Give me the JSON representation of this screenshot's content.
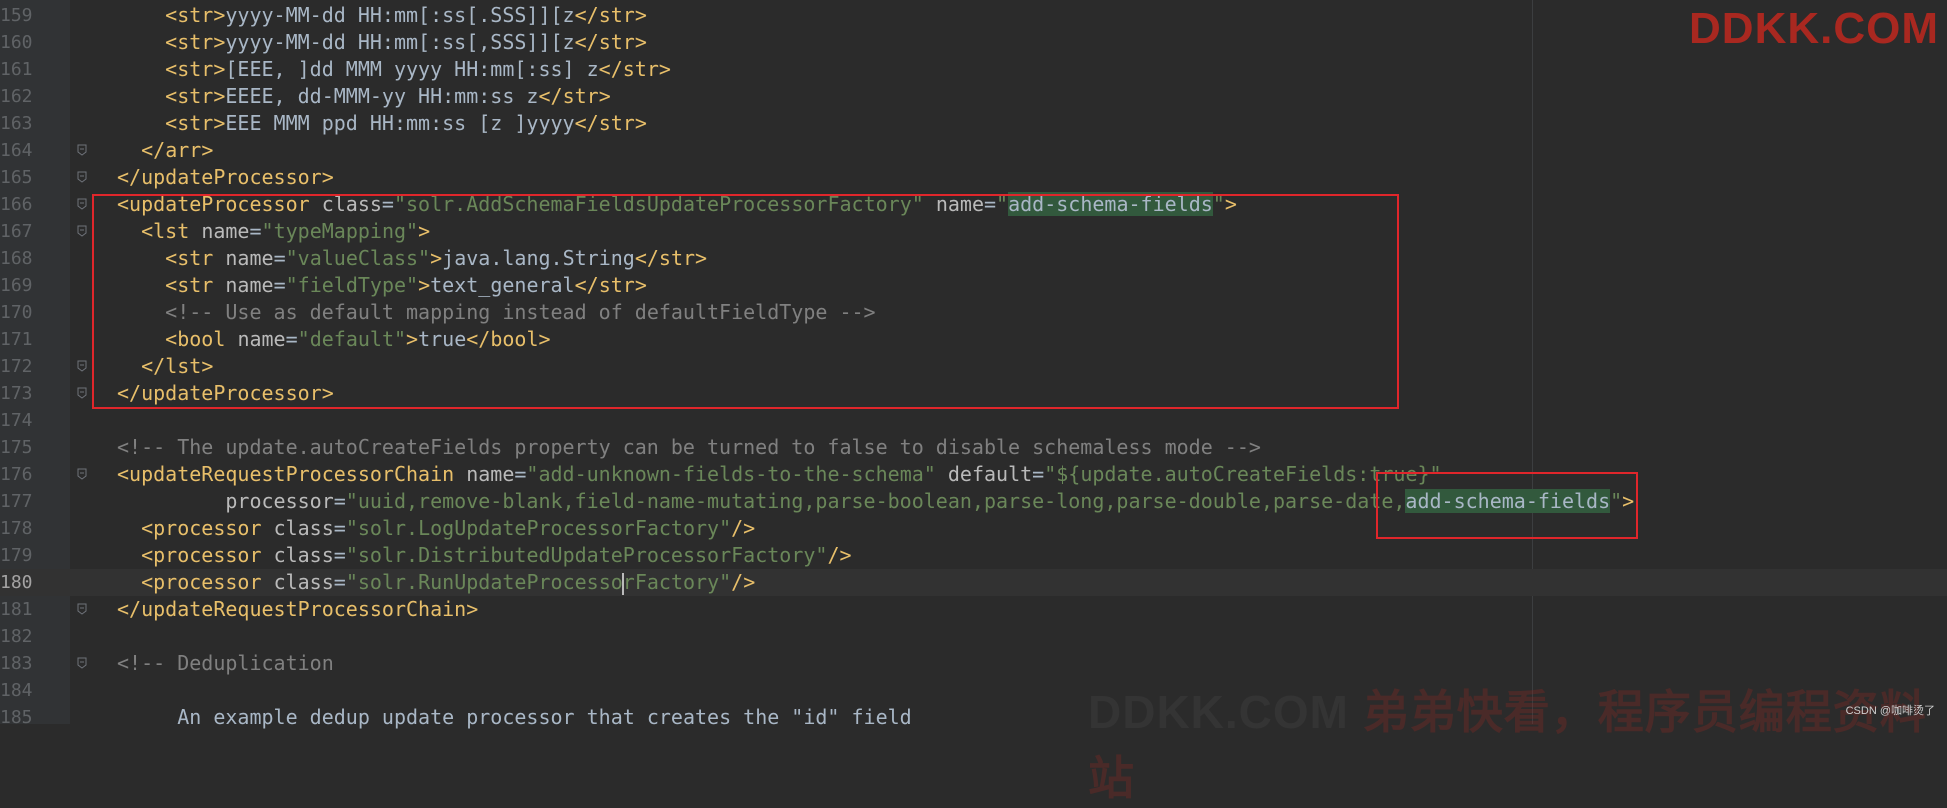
{
  "editor": {
    "current_line": "180",
    "lines": [
      {
        "num": "159",
        "indent": "    ",
        "segments": [
          [
            "ang",
            "<"
          ],
          [
            "tag",
            "str"
          ],
          [
            "ang",
            ">"
          ],
          [
            "txt",
            "yyyy-MM-dd HH:mm[:ss[.SSS]][z"
          ],
          [
            "ang",
            "</"
          ],
          [
            "tag",
            "str"
          ],
          [
            "ang",
            ">"
          ]
        ]
      },
      {
        "num": "160",
        "indent": "    ",
        "segments": [
          [
            "ang",
            "<"
          ],
          [
            "tag",
            "str"
          ],
          [
            "ang",
            ">"
          ],
          [
            "txt",
            "yyyy-MM-dd HH:mm[:ss[,SSS]][z"
          ],
          [
            "ang",
            "</"
          ],
          [
            "tag",
            "str"
          ],
          [
            "ang",
            ">"
          ]
        ]
      },
      {
        "num": "161",
        "indent": "    ",
        "segments": [
          [
            "ang",
            "<"
          ],
          [
            "tag",
            "str"
          ],
          [
            "ang",
            ">"
          ],
          [
            "txt",
            "[EEE, ]dd MMM yyyy HH:mm[:ss] z"
          ],
          [
            "ang",
            "</"
          ],
          [
            "tag",
            "str"
          ],
          [
            "ang",
            ">"
          ]
        ]
      },
      {
        "num": "162",
        "indent": "    ",
        "segments": [
          [
            "ang",
            "<"
          ],
          [
            "tag",
            "str"
          ],
          [
            "ang",
            ">"
          ],
          [
            "txt",
            "EEEE, dd-MMM-yy HH:mm:ss z"
          ],
          [
            "ang",
            "</"
          ],
          [
            "tag",
            "str"
          ],
          [
            "ang",
            ">"
          ]
        ]
      },
      {
        "num": "163",
        "indent": "    ",
        "segments": [
          [
            "ang",
            "<"
          ],
          [
            "tag",
            "str"
          ],
          [
            "ang",
            ">"
          ],
          [
            "txt",
            "EEE MMM ppd HH:mm:ss [z ]yyyy"
          ],
          [
            "ang",
            "</"
          ],
          [
            "tag",
            "str"
          ],
          [
            "ang",
            ">"
          ]
        ]
      },
      {
        "num": "164",
        "indent": "  ",
        "segments": [
          [
            "ang",
            "</"
          ],
          [
            "tag",
            "arr"
          ],
          [
            "ang",
            ">"
          ]
        ]
      },
      {
        "num": "165",
        "indent": "",
        "segments": [
          [
            "ang",
            "</"
          ],
          [
            "tag",
            "updateProcessor"
          ],
          [
            "ang",
            ">"
          ]
        ]
      },
      {
        "num": "166",
        "indent": "",
        "segments": [
          [
            "ang",
            "<"
          ],
          [
            "tag",
            "updateProcessor "
          ],
          [
            "attr",
            "class"
          ],
          [
            "txt",
            "="
          ],
          [
            "val",
            "\"solr.AddSchemaFieldsUpdateProcessorFactory\""
          ],
          [
            "txt",
            " "
          ],
          [
            "attr",
            "name"
          ],
          [
            "txt",
            "="
          ],
          [
            "val",
            "\""
          ],
          [
            "hl",
            "add-schema-fields"
          ],
          [
            "val",
            "\""
          ],
          [
            "ang",
            ">"
          ]
        ]
      },
      {
        "num": "167",
        "indent": "  ",
        "segments": [
          [
            "ang",
            "<"
          ],
          [
            "tag",
            "lst "
          ],
          [
            "attr",
            "name"
          ],
          [
            "txt",
            "="
          ],
          [
            "val",
            "\"typeMapping\""
          ],
          [
            "ang",
            ">"
          ]
        ]
      },
      {
        "num": "168",
        "indent": "    ",
        "segments": [
          [
            "ang",
            "<"
          ],
          [
            "tag",
            "str "
          ],
          [
            "attr",
            "name"
          ],
          [
            "txt",
            "="
          ],
          [
            "val",
            "\"valueClass\""
          ],
          [
            "ang",
            ">"
          ],
          [
            "txt",
            "java.lang.String"
          ],
          [
            "ang",
            "</"
          ],
          [
            "tag",
            "str"
          ],
          [
            "ang",
            ">"
          ]
        ]
      },
      {
        "num": "169",
        "indent": "    ",
        "segments": [
          [
            "ang",
            "<"
          ],
          [
            "tag",
            "str "
          ],
          [
            "attr",
            "name"
          ],
          [
            "txt",
            "="
          ],
          [
            "val",
            "\"fieldType\""
          ],
          [
            "ang",
            ">"
          ],
          [
            "txt",
            "text_general"
          ],
          [
            "ang",
            "</"
          ],
          [
            "tag",
            "str"
          ],
          [
            "ang",
            ">"
          ]
        ]
      },
      {
        "num": "170",
        "indent": "    ",
        "segments": [
          [
            "cmt",
            "<!-- Use as default mapping instead of defaultFieldType -->"
          ]
        ]
      },
      {
        "num": "171",
        "indent": "    ",
        "segments": [
          [
            "ang",
            "<"
          ],
          [
            "tag",
            "bool "
          ],
          [
            "attr",
            "name"
          ],
          [
            "txt",
            "="
          ],
          [
            "val",
            "\"default\""
          ],
          [
            "ang",
            ">"
          ],
          [
            "txt",
            "true"
          ],
          [
            "ang",
            "</"
          ],
          [
            "tag",
            "bool"
          ],
          [
            "ang",
            ">"
          ]
        ]
      },
      {
        "num": "172",
        "indent": "  ",
        "segments": [
          [
            "ang",
            "</"
          ],
          [
            "tag",
            "lst"
          ],
          [
            "ang",
            ">"
          ]
        ]
      },
      {
        "num": "173",
        "indent": "",
        "segments": [
          [
            "ang",
            "</"
          ],
          [
            "tag",
            "updateProcessor"
          ],
          [
            "ang",
            ">"
          ]
        ]
      },
      {
        "num": "174",
        "indent": "",
        "segments": []
      },
      {
        "num": "175",
        "indent": "",
        "segments": [
          [
            "cmt",
            "<!-- The update.autoCreateFields property can be turned to false to disable schemaless mode -->"
          ]
        ]
      },
      {
        "num": "176",
        "indent": "",
        "segments": [
          [
            "ang",
            "<"
          ],
          [
            "tag",
            "updateRequestProcessorChain "
          ],
          [
            "attr",
            "name"
          ],
          [
            "txt",
            "="
          ],
          [
            "val",
            "\"add-unknown-fields-to-the-schema\""
          ],
          [
            "txt",
            " "
          ],
          [
            "attr",
            "default"
          ],
          [
            "txt",
            "="
          ],
          [
            "val",
            "\"${update.autoCreateFields:true}\""
          ]
        ]
      },
      {
        "num": "177",
        "indent": "         ",
        "segments": [
          [
            "attr",
            "processor"
          ],
          [
            "txt",
            "="
          ],
          [
            "val",
            "\"uuid,remove-blank,field-name-mutating,parse-boolean,parse-long,parse-double,parse-date,"
          ],
          [
            "hl",
            "add-schema-fields"
          ],
          [
            "val",
            "\""
          ],
          [
            "ang",
            ">"
          ]
        ]
      },
      {
        "num": "178",
        "indent": "  ",
        "segments": [
          [
            "ang",
            "<"
          ],
          [
            "tag",
            "processor "
          ],
          [
            "attr",
            "class"
          ],
          [
            "txt",
            "="
          ],
          [
            "val",
            "\"solr.LogUpdateProcessorFactory\""
          ],
          [
            "ang",
            "/>"
          ]
        ]
      },
      {
        "num": "179",
        "indent": "  ",
        "segments": [
          [
            "ang",
            "<"
          ],
          [
            "tag",
            "processor "
          ],
          [
            "attr",
            "class"
          ],
          [
            "txt",
            "="
          ],
          [
            "val",
            "\"solr.DistributedUpdateProcessorFactory\""
          ],
          [
            "ang",
            "/>"
          ]
        ]
      },
      {
        "num": "180",
        "indent": "  ",
        "segments": [
          [
            "ang",
            "<"
          ],
          [
            "tag",
            "processor "
          ],
          [
            "attr",
            "class"
          ],
          [
            "txt",
            "="
          ],
          [
            "val",
            "\"solr.RunUpdateProcesso"
          ],
          [
            "caret",
            ""
          ],
          [
            "val",
            "rFactory\""
          ],
          [
            "ang",
            "/>"
          ]
        ]
      },
      {
        "num": "181",
        "indent": "",
        "segments": [
          [
            "ang",
            "</"
          ],
          [
            "tag",
            "updateRequestProcessorChain"
          ],
          [
            "ang",
            ">"
          ]
        ]
      },
      {
        "num": "182",
        "indent": "",
        "segments": []
      },
      {
        "num": "183",
        "indent": "",
        "segments": [
          [
            "cmt",
            "<!-- Deduplication"
          ]
        ]
      },
      {
        "num": "184",
        "indent": "",
        "segments": []
      },
      {
        "num": "185",
        "indent": "     ",
        "segments": [
          [
            "txt",
            "An example dedup update processor that creates the \"id\" field"
          ]
        ]
      }
    ]
  },
  "watermarks": {
    "top": "DDKK.COM",
    "bottom_en": "DDKK.COM",
    "bottom_cn": "弟弟快看，程序员编程资料站",
    "corner": "CSDN @咖啡烫了"
  },
  "colors": {
    "background": "#2b2b2b",
    "annotation_box": "#e0262b",
    "match_highlight": "#32593d"
  }
}
